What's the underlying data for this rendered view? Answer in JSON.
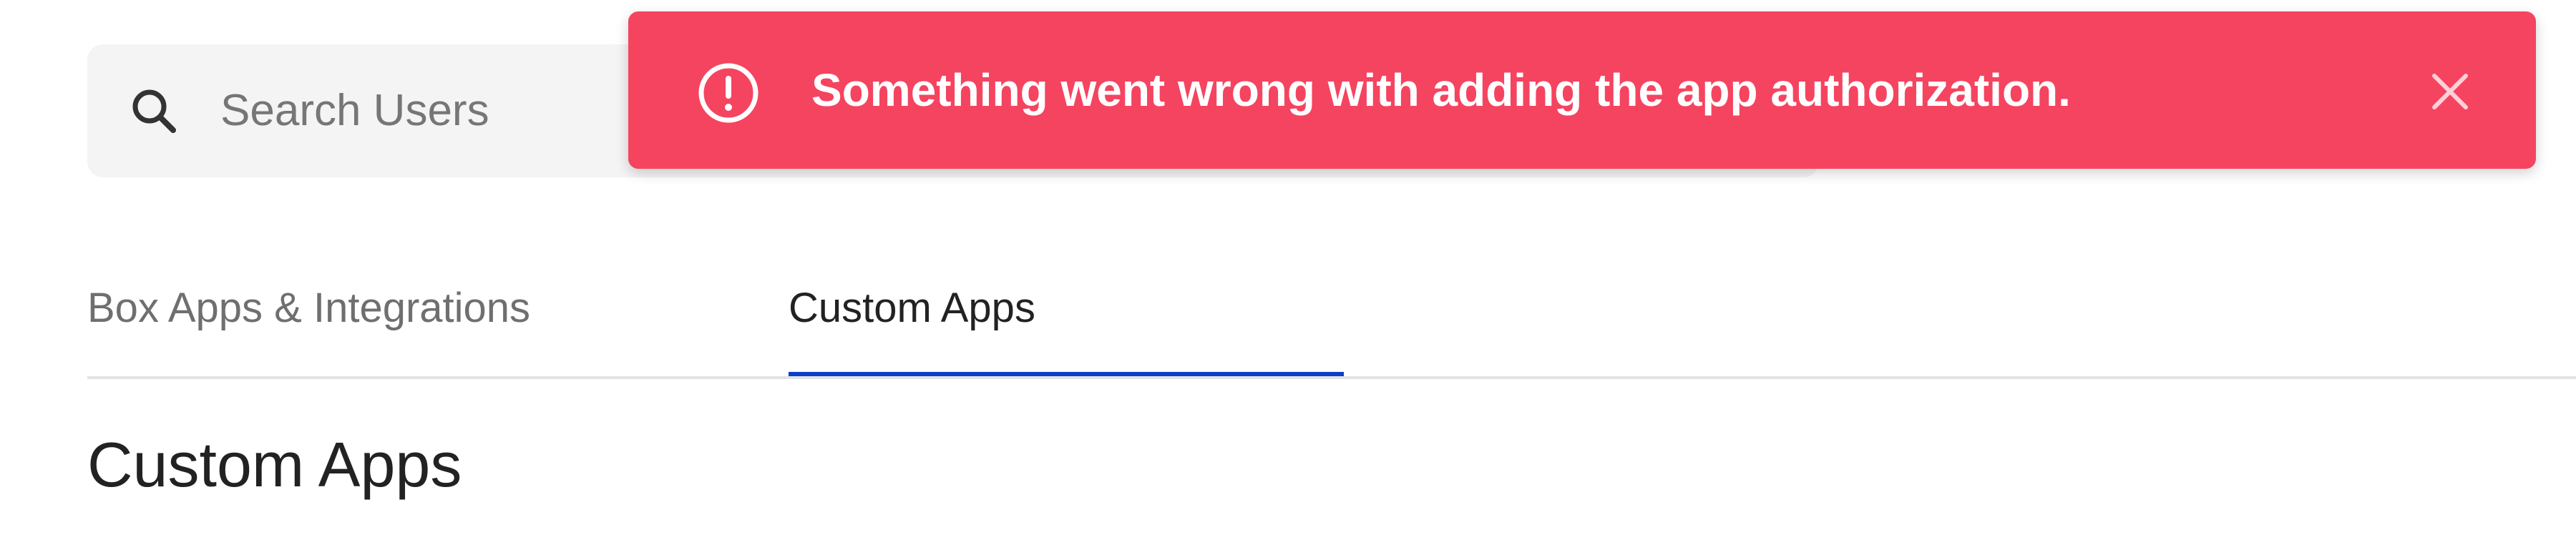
{
  "search": {
    "placeholder": "Search Users",
    "icon": "search-icon"
  },
  "toast": {
    "type": "error",
    "message": "Something went wrong with adding the app authorization.",
    "icon": "alert-circle-icon",
    "close_icon": "close-icon",
    "background_color": "#f54460",
    "text_color": "#ffffff"
  },
  "tabs": [
    {
      "label": "Box Apps & Integrations",
      "active": false
    },
    {
      "label": "Custom Apps",
      "active": true
    }
  ],
  "tab_active_color": "#0b3fc9",
  "page_title": "Custom Apps"
}
